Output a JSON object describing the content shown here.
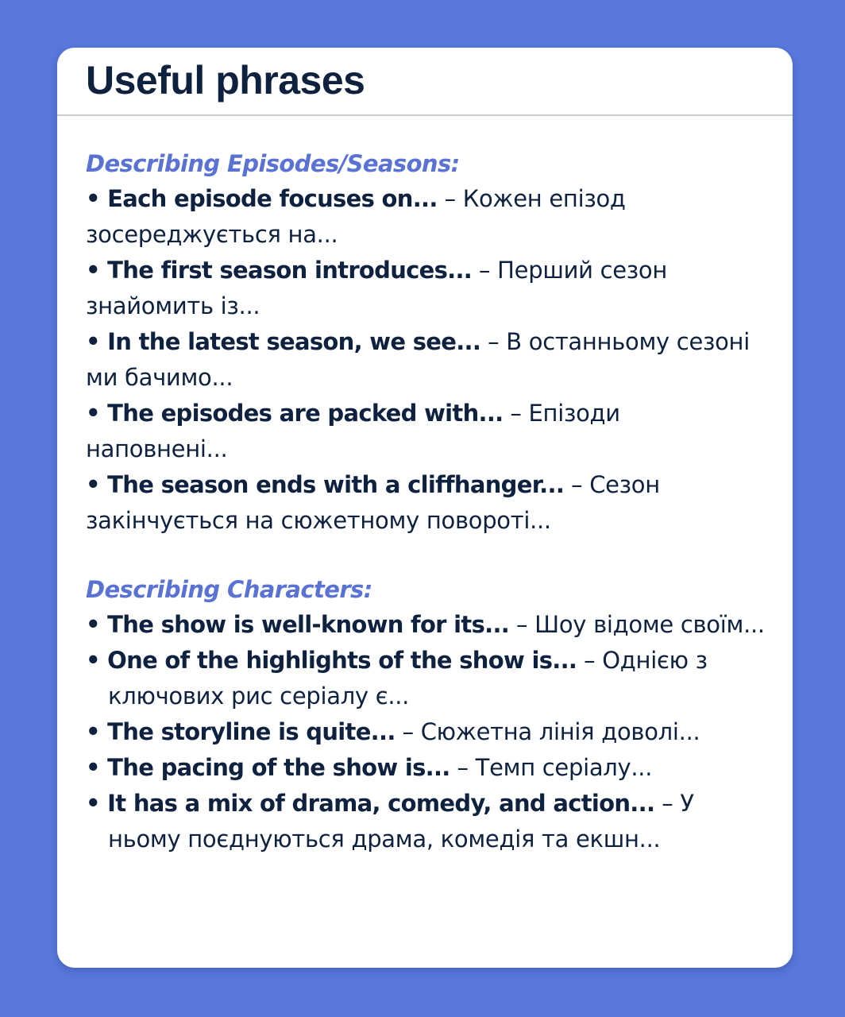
{
  "card": {
    "title": "Useful phrases"
  },
  "sections": [
    {
      "heading": "Describing Episodes/Seasons:",
      "items": [
        {
          "bullet": "•",
          "en": "Each episode focuses on...",
          "dash": "–",
          "ua": "Кожен епізод зосереджується на..."
        },
        {
          "bullet": "•",
          "en": "The first season introduces...",
          "dash": "–",
          "ua": "Перший сезон знайомить із..."
        },
        {
          "bullet": "•",
          "en": "In the latest season, we see...",
          "dash": "–",
          "ua": "В останньому сезоні ми бачимо..."
        },
        {
          "bullet": "•",
          "en": "The episodes are packed with...",
          "dash": "–",
          "ua": "Епізоди наповнені..."
        },
        {
          "bullet": "•",
          "en": "The season ends with a cliffhanger...",
          "dash": "–",
          "ua": "Сезон закінчується на сюжетному повороті..."
        }
      ]
    },
    {
      "heading": "Describing Characters:",
      "items": [
        {
          "bullet": "•",
          "en": "The show is well-known for its...",
          "dash": "–",
          "ua": "Шоу відоме своїм..."
        },
        {
          "bullet": "•",
          "en": "One of the highlights of the show is...",
          "dash": "–",
          "ua": "Однією з ключових рис серіалу є..."
        },
        {
          "bullet": "•",
          "en": "The storyline is quite...",
          "dash": "–",
          "ua": "Сюжетна лінія доволі..."
        },
        {
          "bullet": "•",
          "en": "The pacing of the show is...",
          "dash": "–",
          "ua": "Темп серіалу..."
        },
        {
          "bullet": "•",
          "en": "It has a mix of drama, comedy, and action...",
          "dash": "–",
          "ua": "У ньому поєднуються драма, комедія та екшн..."
        }
      ]
    }
  ],
  "colors": {
    "background": "#5878dc",
    "card": "#ffffff",
    "title": "#0e2240",
    "heading": "#5a72d4",
    "text": "#0e2240",
    "divider": "#c8cad0"
  }
}
